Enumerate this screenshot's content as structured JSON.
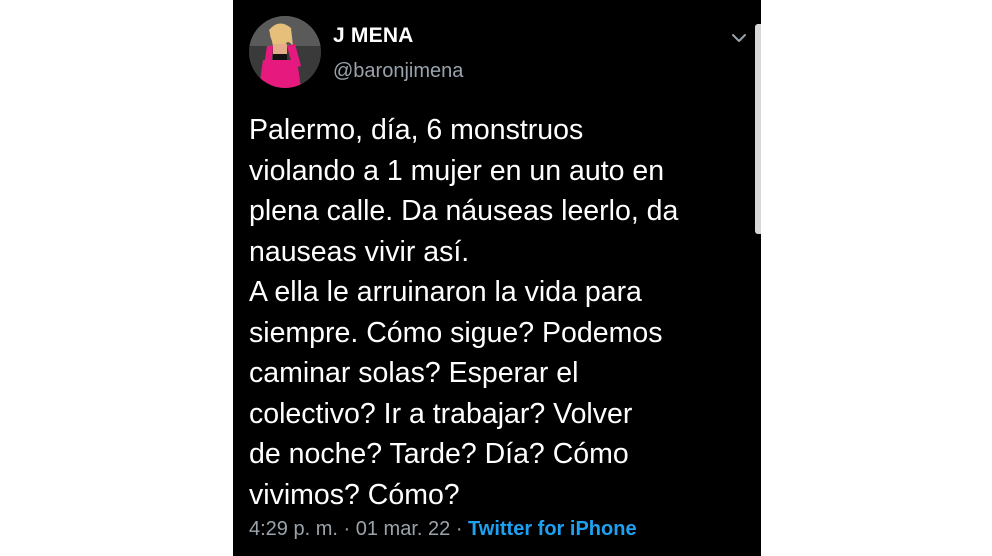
{
  "colors": {
    "background": "#000000",
    "text": "#ffffff",
    "muted": "#9aa3ab",
    "link": "#1da1f2",
    "avatar_outfit": "#e6197e"
  },
  "author": {
    "display_name": "J MENA",
    "handle": "@baronjimena",
    "avatar_icon": "profile-photo"
  },
  "menu_icon": "chevron-down-icon",
  "tweet": {
    "text": "Palermo, día, 6 monstruos\nviolando a 1 mujer en un auto en\nplena calle. Da náuseas leerlo, da\nnauseas vivir así.\nA ella le arruinaron la vida para\nsiempre. Cómo sigue? Podemos\ncaminar solas? Esperar el\ncolectivo? Ir a trabajar? Volver\nde noche? Tarde? Día? Cómo\nvivimos? Cómo?"
  },
  "meta": {
    "time": "4:29 p. m.",
    "separator": "·",
    "date": "01 mar. 22",
    "source": "Twitter for iPhone"
  }
}
